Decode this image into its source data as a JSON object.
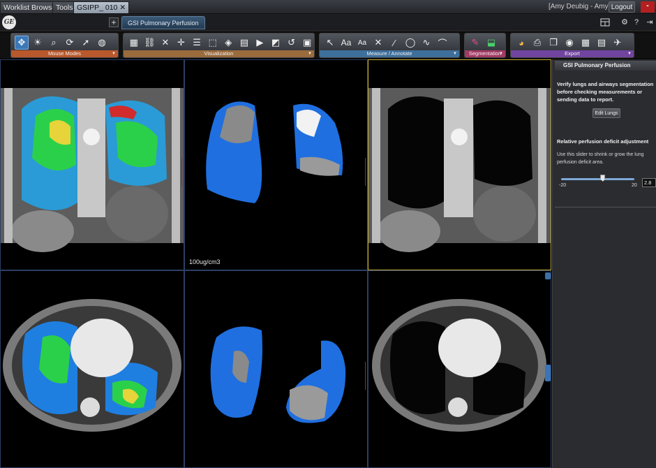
{
  "topbar": {
    "tabs": [
      {
        "label": "Worklist Browser"
      },
      {
        "label": "Tools"
      },
      {
        "label": "GSIPP_ 010",
        "close": "✕"
      }
    ],
    "user": "[Amy Deubig - Amy]",
    "logout": "Logout",
    "minimize": "-"
  },
  "bar2": {
    "logo_text": "GE",
    "add_tab": "+",
    "app_tab": "GSI Pulmonary Perfusion",
    "right_icons": [
      "layout-icon",
      "gear-icon",
      "help-icon",
      "exit-icon"
    ]
  },
  "toolbar": {
    "groups": [
      {
        "label": "Mouse Modes",
        "color": "#b8582c"
      },
      {
        "label": "Visualization",
        "color": "#9a6b3c"
      },
      {
        "label": "Measure / Annotate",
        "color": "#3e6f9b"
      },
      {
        "label": "Segmentation",
        "color": "#a23a64"
      },
      {
        "label": "Export",
        "color": "#7144a0"
      }
    ],
    "measure_text_tools": [
      "Aa",
      "Aa"
    ]
  },
  "viewports": {
    "middle_top_label": "100ug/cm3"
  },
  "panel": {
    "title": "GSI Pulmonary Perfusion",
    "message": "Verify lungs and airways segmentation before checking measurements or sending data to report.",
    "edit_lungs": "Edit Lungs",
    "adjust_title": "Relative perfusion deficit adjustment",
    "adjust_help": "Use this slider to shrink or grow the lung perfusion deficit area.",
    "slider": {
      "min_label": "-20",
      "max_label": "20",
      "value": "2.8",
      "min": -20,
      "max": 20,
      "current": 2.8
    }
  }
}
